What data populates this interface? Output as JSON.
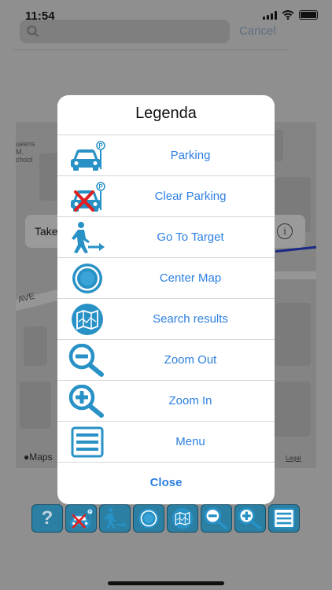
{
  "status_bar": {
    "time": "11:54"
  },
  "search": {
    "cancel_label": "Cancel"
  },
  "map": {
    "school_label": "ueens\nM.\nchool",
    "street_label": "AVE",
    "callout_text": "Take",
    "attribution": "Maps",
    "legal_label": "Legal"
  },
  "legend": {
    "title": "Legenda",
    "items": [
      {
        "label": "Parking",
        "icon": "parking-icon"
      },
      {
        "label": "Clear Parking",
        "icon": "clear-parking-icon"
      },
      {
        "label": "Go To Target",
        "icon": "go-to-target-icon"
      },
      {
        "label": "Center Map",
        "icon": "center-map-icon"
      },
      {
        "label": "Search results",
        "icon": "search-results-icon"
      },
      {
        "label": "Zoom Out",
        "icon": "zoom-out-icon"
      },
      {
        "label": "Zoom In",
        "icon": "zoom-in-icon"
      },
      {
        "label": "Menu",
        "icon": "menu-icon"
      }
    ],
    "close_label": "Close"
  },
  "toolbar": {
    "help_label": "?"
  },
  "colors": {
    "icon_blue": "#2891c6",
    "link_blue": "#2c7fe0",
    "toolbar_blue": "#2a7fa3"
  }
}
